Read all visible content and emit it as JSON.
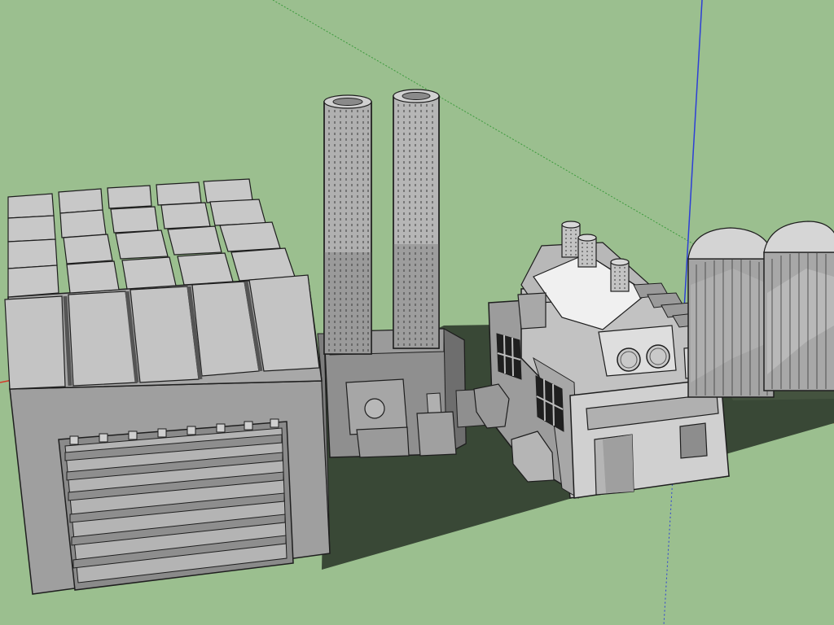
{
  "colors": {
    "background": "#9bbf8f",
    "ground_shadow": "#3b4a38",
    "outline": "#1e1e1e",
    "light": "#c9c9c9",
    "mid": "#a9a9a9",
    "dark": "#7c7c7c",
    "axis_red": "#d43a2a",
    "axis_green": "#3c9a3c",
    "axis_blue": "#2d3fd6"
  }
}
